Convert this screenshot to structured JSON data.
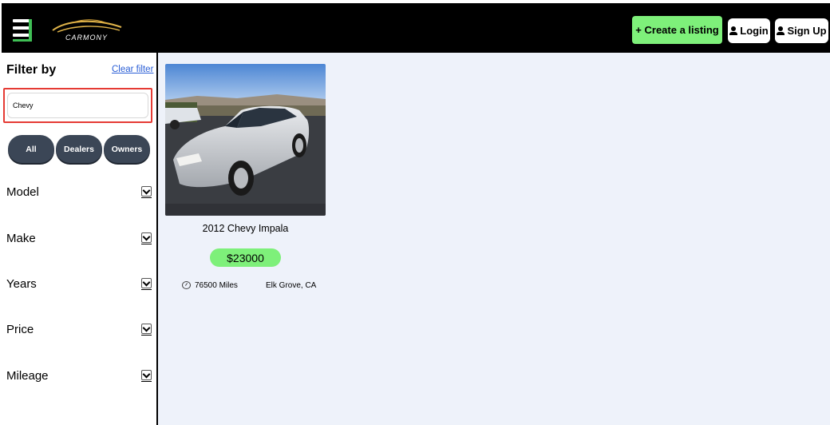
{
  "header": {
    "logo_text": "CARMONY",
    "create_listing_label": "+ Create a listing",
    "login_label": "Login",
    "signup_label": "Sign Up",
    "colors": {
      "bar": "#000000",
      "accent_green": "#7ef07a"
    }
  },
  "sidebar": {
    "title": "Filter by",
    "clear_filter_label": "Clear filter",
    "search": {
      "value": "Chevy"
    },
    "segments": [
      "All",
      "Dealers",
      "Owners"
    ],
    "facets": [
      "Model",
      "Make",
      "Years",
      "Price",
      "Mileage"
    ]
  },
  "listings": [
    {
      "title": "2012 Chevy Impala",
      "price": "$23000",
      "mileage": "76500 Miles",
      "location": "Elk Grove, CA"
    }
  ]
}
